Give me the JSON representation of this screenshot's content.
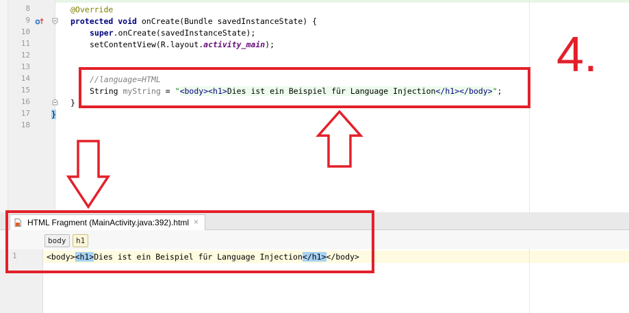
{
  "editor": {
    "line_numbers": [
      "8",
      "9",
      "10",
      "11",
      "12",
      "13",
      "14",
      "15",
      "16",
      "17",
      "18"
    ],
    "lines": {
      "l8_annotation": "@Override",
      "l9_kw1": "protected",
      "l9_kw2": "void",
      "l9_rest": " onCreate(Bundle savedInstanceState) {",
      "l10_kw": "super",
      "l10_rest": ".onCreate(savedInstanceState);",
      "l11_method": "setContentView(R.layout.",
      "l11_field": "activity_main",
      "l11_end": ");",
      "l14_comment": "//language=HTML",
      "l15_type": "String ",
      "l15_var": "myString",
      "l15_eq": " = ",
      "l15_q1": "\"",
      "l15_t1": "<body>",
      "l15_t2": "<h1>",
      "l15_text": "Dies ist ein Beispiel für Language Injection",
      "l15_t3": "</h1>",
      "l15_t4": "</body>",
      "l15_q2": "\"",
      "l15_end": ";",
      "l16_brace": "}",
      "l17_brace": "}"
    }
  },
  "panel": {
    "tab_label": "HTML Fragment (MainActivity.java:392).html",
    "tab_close": "×",
    "breadcrumbs": [
      "body",
      "h1"
    ],
    "fragment_line_number": "1",
    "fragment": {
      "open_body": "<body>",
      "open_h1": "<h1>",
      "text": "Dies ist ein Beispiel für Language Injection",
      "close_h1": "</h1>",
      "close_body": "</body>"
    }
  },
  "annotation": {
    "step_number": "4.",
    "color": "#e3202a"
  },
  "icons": {
    "override_marker": "override-gutter-icon",
    "fold_markers": "fold-icon",
    "html_file": "html-file-icon"
  }
}
